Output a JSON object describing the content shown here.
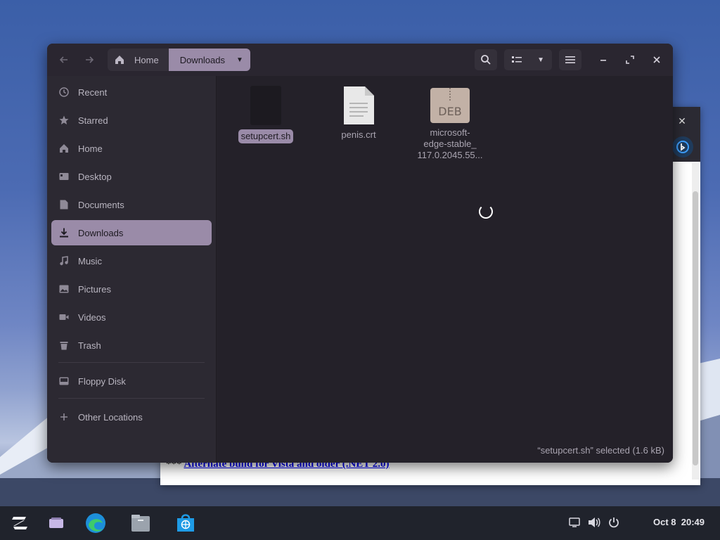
{
  "file_manager": {
    "path": {
      "home": "Home",
      "current": "Downloads"
    },
    "sidebar": {
      "items": [
        {
          "label": "Recent",
          "icon": "clock-icon",
          "active": false
        },
        {
          "label": "Starred",
          "icon": "star-icon",
          "active": false
        },
        {
          "label": "Home",
          "icon": "home-icon",
          "active": false
        },
        {
          "label": "Desktop",
          "icon": "desktop-icon",
          "active": false
        },
        {
          "label": "Documents",
          "icon": "document-icon",
          "active": false
        },
        {
          "label": "Downloads",
          "icon": "download-icon",
          "active": true
        },
        {
          "label": "Music",
          "icon": "music-icon",
          "active": false
        },
        {
          "label": "Pictures",
          "icon": "picture-icon",
          "active": false
        },
        {
          "label": "Videos",
          "icon": "video-icon",
          "active": false
        },
        {
          "label": "Trash",
          "icon": "trash-icon",
          "active": false
        }
      ],
      "devices": [
        {
          "label": "Floppy Disk",
          "icon": "drive-icon"
        }
      ],
      "other": {
        "label": "Other Locations",
        "icon": "plus-icon"
      }
    },
    "files": [
      {
        "name": "setupcert.sh",
        "type": "script",
        "selected": true
      },
      {
        "name": "penis.crt",
        "type": "text"
      },
      {
        "name_lines": [
          "microsoft-",
          "edge-stable_",
          "117.0.2045.55..."
        ],
        "type": "deb",
        "badge": "DEB"
      }
    ],
    "status": "“setupcert.sh” selected  (1.6 kB)"
  },
  "background_window": {
    "link_prefix": "***",
    "link_text": "Alternate build for Vista and older (.NET 2.0)",
    "close": "✕"
  },
  "taskbar": {
    "date": "Oct 8",
    "time": "20:49"
  },
  "colors": {
    "accent": "#9a8ba8",
    "window_bg": "#242129",
    "sidebar_bg": "#2c2932"
  }
}
